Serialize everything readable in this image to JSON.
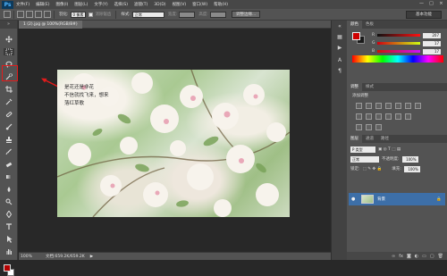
{
  "app": {
    "logo": "Ps"
  },
  "menu": [
    "文件(F)",
    "编辑(E)",
    "图像(I)",
    "图层(L)",
    "文字(Y)",
    "选择(S)",
    "滤镜(T)",
    "3D(D)",
    "视图(V)",
    "窗口(W)",
    "帮助(H)"
  ],
  "window_controls": [
    "—",
    "□",
    "×"
  ],
  "options": {
    "feather_label": "羽化:",
    "feather_value": "0 像素",
    "antialias_label": "消除锯齿",
    "style_label": "样式:",
    "style_value": "正常",
    "width_label": "宽度:",
    "height_label": "高度:",
    "refine_button": "调整边缘...",
    "workspace": "基本功能"
  },
  "document": {
    "tab_title": "1 (2).jpg @ 100%(RGB/8#)",
    "zoom": "100%",
    "doc_info": "文档:659.2K/659.2K",
    "poem_lines": [
      "是花还是非花",
      "不信就找飞来，想来",
      "落红草歌"
    ]
  },
  "panels": {
    "color_tabs": [
      "颜色",
      "色板"
    ],
    "rgb": [
      {
        "channel": "R",
        "value": "207"
      },
      {
        "channel": "G",
        "value": "17"
      },
      {
        "channel": "B",
        "value": "17"
      }
    ],
    "adjust_tabs": [
      "调整",
      "样式"
    ],
    "adjust_title": "添加调整",
    "layers_tabs": [
      "图层",
      "通道",
      "路径"
    ],
    "kind_label": "P 类型",
    "blend_mode": "正常",
    "opacity_label": "不透明度:",
    "opacity_value": "100%",
    "lock_label": "锁定:",
    "fill_label": "填充:",
    "fill_value": "100%",
    "layer_name": "背景",
    "layer_lock_icon": "lock-icon"
  },
  "colors": {
    "foreground": "#cf0000",
    "background": "#1a1a1a",
    "highlight": "#e21b1b"
  }
}
